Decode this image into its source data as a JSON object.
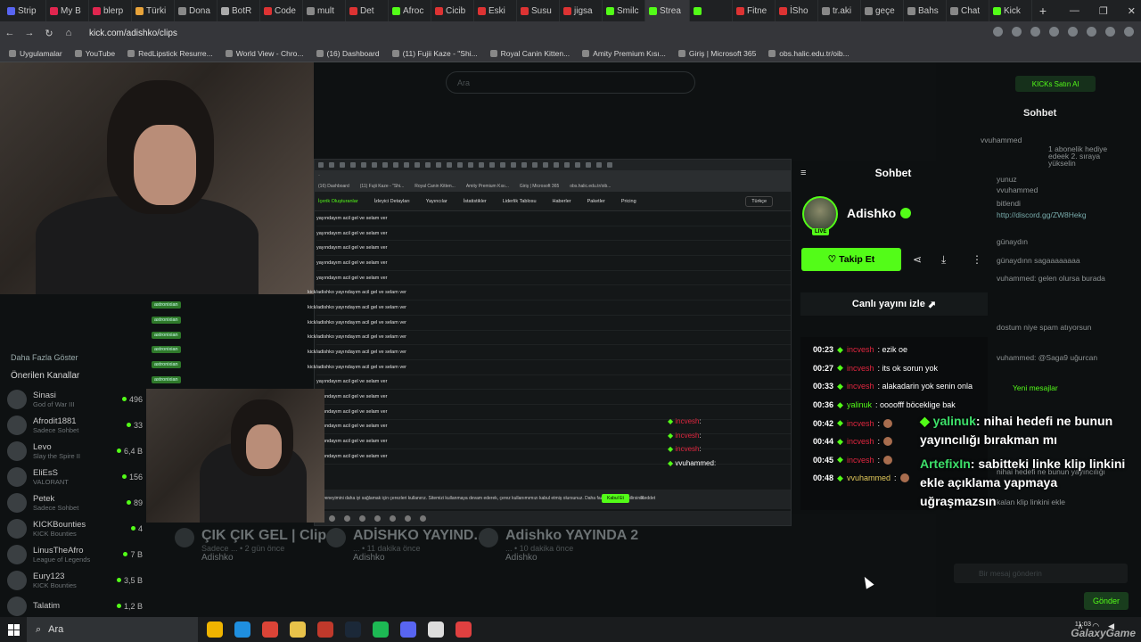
{
  "browser": {
    "tabs": [
      "Strip",
      "My B",
      "blerp",
      "Türki",
      "Dona",
      "BotR",
      "Code",
      "mult",
      "Det",
      "Afroc",
      "Cicib",
      "Eski",
      "Susu",
      "jigsa",
      "Smilc",
      "Strea",
      "",
      "Fitne",
      "İSho",
      "tr.aki",
      "geçe",
      "Bahs",
      "Chat",
      "Kick"
    ],
    "url": "kick.com/adishko/clips",
    "bookmarks": [
      "Uygulamalar",
      "YouTube",
      "RedLipstick Resurre...",
      "World View - Chro...",
      "(16) Dashboard",
      "(11) Fujii Kaze - \"Shi...",
      "Royal Canin Kitten...",
      "Amity Premium Kısı...",
      "Giriş | Microsoft 365",
      "obs.halic.edu.tr/oib..."
    ]
  },
  "topsearch": {
    "placeholder": "Ara"
  },
  "kick_buy": "KICKs Satın Al",
  "sidebar": {
    "show_more": "Daha Fazla Göster",
    "recommended": "Önerilen Kanallar",
    "channels": [
      {
        "name": "Sinasi",
        "game": "God of War III",
        "viewers": "496"
      },
      {
        "name": "Afrodit1881",
        "game": "Sadece Sohbet",
        "viewers": "33"
      },
      {
        "name": "Levo",
        "game": "Slay the Spire II",
        "viewers": "6,4 B"
      },
      {
        "name": "EliEsS",
        "game": "VALORANT",
        "viewers": "156"
      },
      {
        "name": "Petek",
        "game": "Sadece Sohbet",
        "viewers": "89"
      },
      {
        "name": "KICKBounties",
        "game": "KICK Bounties",
        "viewers": "4"
      },
      {
        "name": "LinusTheAfro",
        "game": "League of Legends",
        "viewers": "7 B"
      },
      {
        "name": "Eury123",
        "game": "KICK Bounties",
        "viewers": "3,5 B"
      },
      {
        "name": "Talatim",
        "game": "",
        "viewers": "1,2 B"
      }
    ]
  },
  "clips": [
    {
      "title": "ÇIK ÇIK GEL | Clip",
      "sub": "Sadece ... • 2 gün önce",
      "author": "Adishko"
    },
    {
      "title": "ADİSHKO YAYIND...",
      "sub": "... • 11 dakika önce",
      "author": "Adishko"
    },
    {
      "title": "Adishko YAYINDA 2",
      "sub": "... • 10 dakika önce",
      "author": "Adishko"
    }
  ],
  "inner": {
    "nav": [
      "İçerik Oluşturanlar",
      "İzleyici Detayları",
      "Yayıncılar",
      "İstatistikler",
      "Liderlik Tablosu",
      "Haberler",
      "Paketler",
      "Pricing"
    ],
    "lang": "Türkçe",
    "row_text": "yayındayım acil gel ve selam ver",
    "row_full": "kick/adishko yayındayım acil gel ve selam ver",
    "row_user": "astronixian",
    "cookie": "Deneyimini daha iyi sağlamak için çerezleri kullanırız. Sitemizi kullanmaya devam ederek, çerez kullanımımızı kabul etmiş olursunuz. Daha fazla bilgi edinebilirsiniz.",
    "accept": "Kabul Et",
    "reject": "Reddet",
    "mini_chat": [
      {
        "user": "incvesh",
        "text": ":"
      },
      {
        "user": "incvesh",
        "text": ":"
      },
      {
        "user": "incvesh",
        "text": ":"
      },
      {
        "user": "vvuhammed",
        "text": ":"
      }
    ]
  },
  "popout": {
    "title": "Sohbet",
    "streamer": "Adishko",
    "live_badge": "LIVE",
    "follow": "Takip Et",
    "watch": "Canlı yayını izle",
    "messages": [
      {
        "time": "00:23",
        "user": "incvesh",
        "text": ": ezik oe"
      },
      {
        "time": "00:27",
        "user": "incvesh",
        "text": ": its ok sorun yok"
      },
      {
        "time": "00:33",
        "user": "incvesh",
        "text": ": alakadarin yok senin onla"
      },
      {
        "time": "00:36",
        "user": "yalinuk",
        "text": ": oooofff böceklige bak"
      },
      {
        "time": "00:42",
        "user": "incvesh",
        "text": ":"
      },
      {
        "time": "00:44",
        "user": "incvesh",
        "text": ":"
      },
      {
        "time": "00:45",
        "user": "incvesh",
        "text": ":"
      },
      {
        "time": "00:48",
        "user": "vvuhammed",
        "text": ":"
      }
    ]
  },
  "right": {
    "title": "Sohbet",
    "msgs": [
      "vvuhammed",
      "1 abonelik hediye",
      "edeek 2. sıraya",
      "yükselin",
      "yunuz",
      "vvuhammed",
      "bitlendi",
      "http://discord.gg/ZW8Hekg",
      "günaydın",
      "günaydınn sagaaaaaaaa",
      "vuhammed: gelen olursa burada",
      "dostum niye spam atıyorsun",
      "vuhammed: @Saga9 uğurcan",
      "Yeni mesajlar",
      "nihai hedefi ne bunun yayıncılığı",
      "kalan klip linkini ekle"
    ],
    "new_msgs": "Yeni mesajlar",
    "send_placeholder": "Bir mesaj gönderin",
    "send": "Gönder",
    "count": "0"
  },
  "overlay": [
    {
      "user": "yalinuk",
      "text": ": nihai hedefi ne bunun yayıncılığı bırakman mı"
    },
    {
      "user": "ArtefixIn",
      "text": ": sabitteki linke klip linkini ekle açıklama yapmaya uğraşmazsın"
    }
  ],
  "taskbar": {
    "search": "Ara",
    "time": "11:03",
    "watermark": "GalaxyGame"
  },
  "colors": {
    "kick_green": "#53fc18",
    "red_user": "#e0263f"
  }
}
